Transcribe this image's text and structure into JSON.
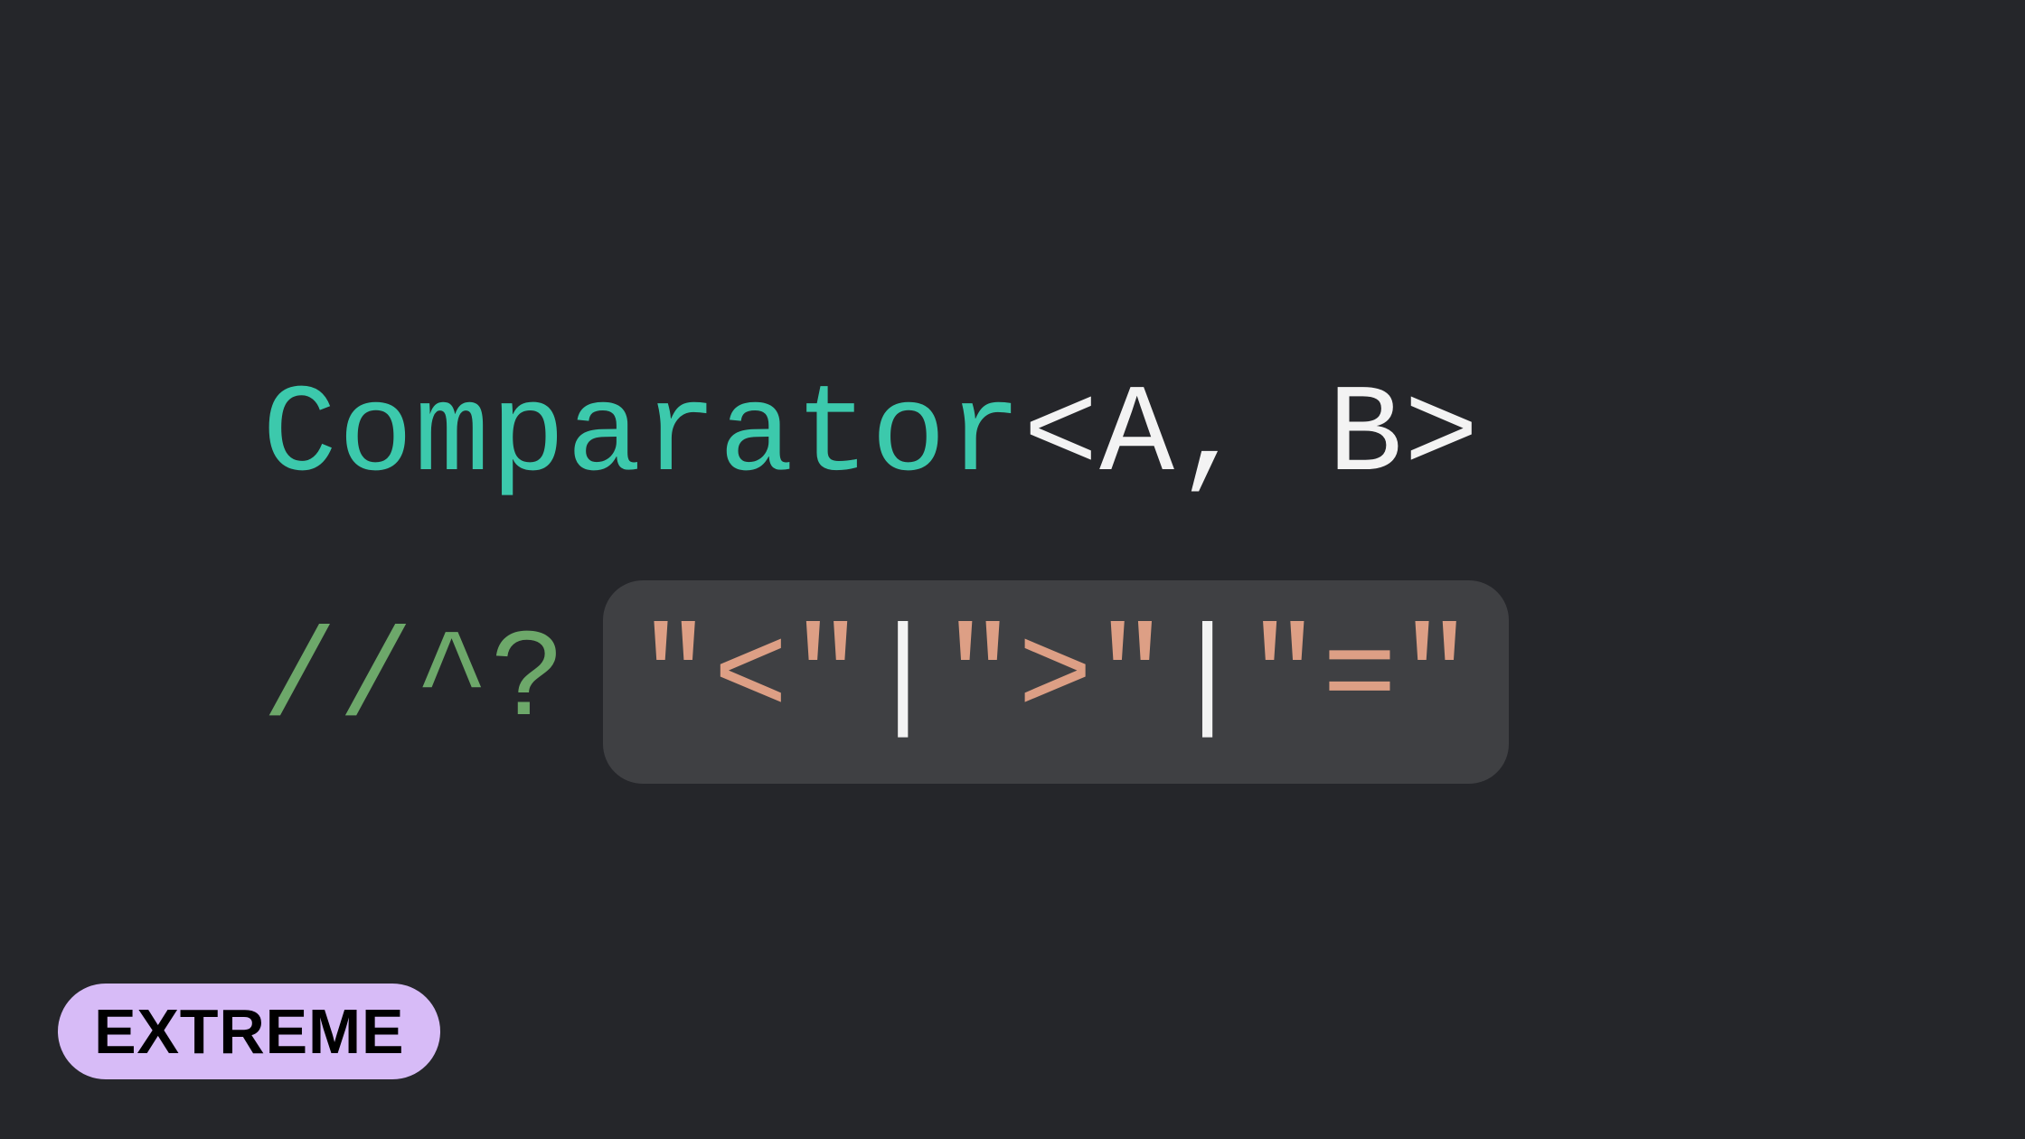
{
  "code": {
    "type_name": "Comparator",
    "open_angle": "<",
    "param_a": "A",
    "comma": ", ",
    "param_b": "B",
    "close_angle": ">",
    "comment": "//^?",
    "result": {
      "q": "\"",
      "lt": "<",
      "gt": ">",
      "eq": "=",
      "pipe": "|"
    }
  },
  "badge": "EXTREME"
}
